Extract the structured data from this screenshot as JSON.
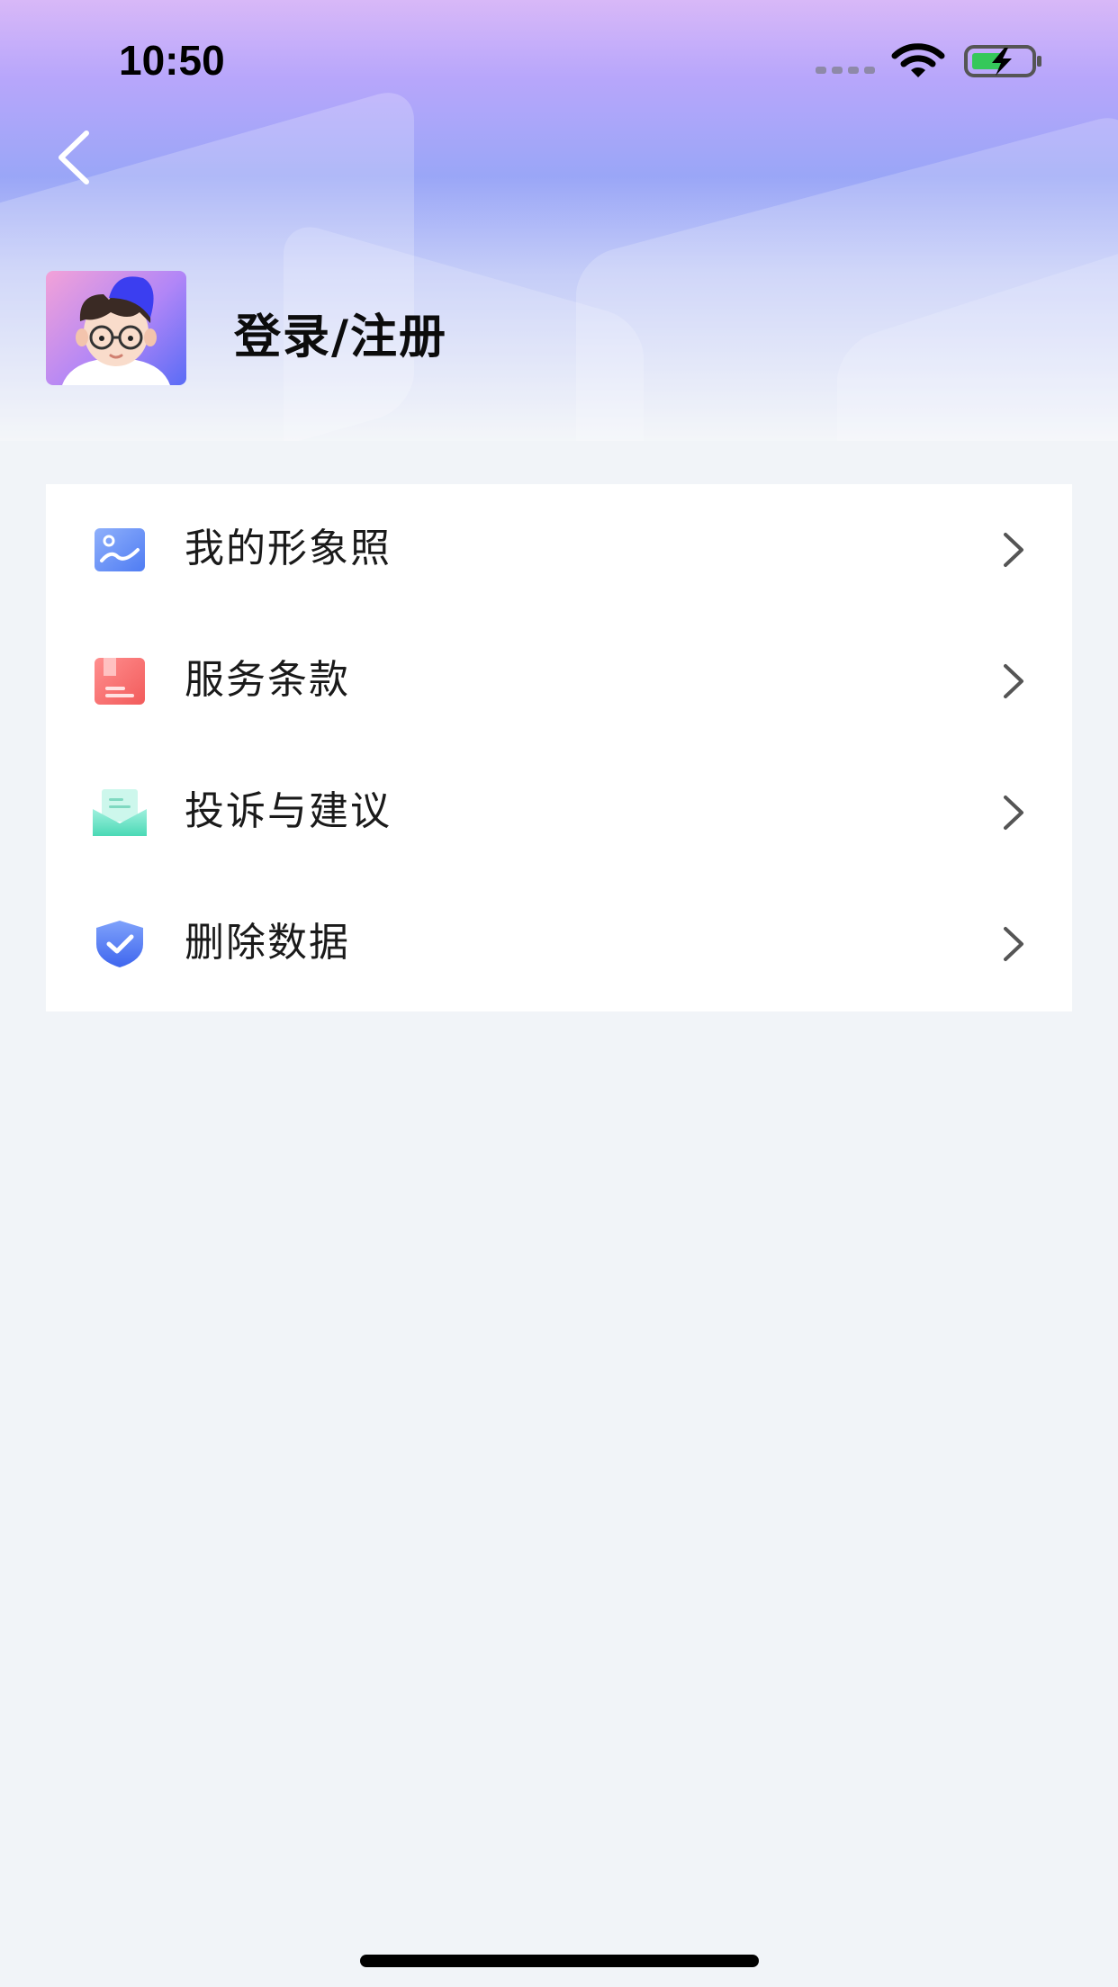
{
  "status_bar": {
    "time": "10:50"
  },
  "header": {
    "login_label": "登录/注册"
  },
  "menu": {
    "items": [
      {
        "label": "我的形象照",
        "icon": "portrait-photo-icon"
      },
      {
        "label": "服务条款",
        "icon": "terms-book-icon"
      },
      {
        "label": "投诉与建议",
        "icon": "feedback-mail-icon"
      },
      {
        "label": "删除数据",
        "icon": "shield-check-icon"
      }
    ]
  },
  "colors": {
    "header_gradient_top": "#d8b8f8",
    "header_gradient_mid": "#9aa6f7",
    "page_background": "#f1f4f8",
    "card_background": "#ffffff"
  }
}
